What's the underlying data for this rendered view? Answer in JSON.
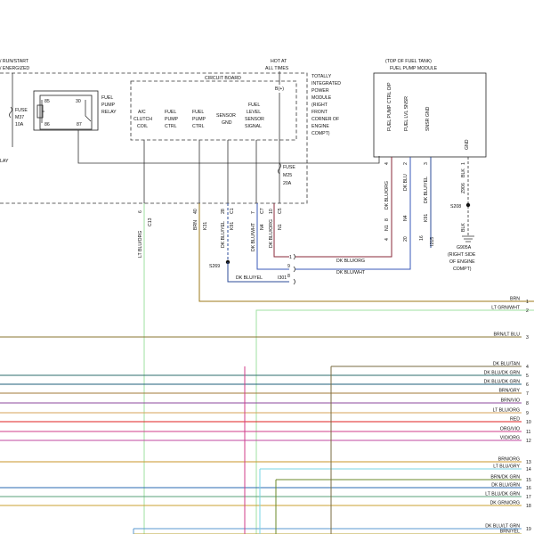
{
  "top_labels": {
    "run_start": "/ RUN/START",
    "energized": "/ ENERGIZED",
    "hot_at": "HOT AT",
    "all_times": "ALL TIMES",
    "circuit_board": "CIRCUIT BOARD",
    "b_plus": "B(+)"
  },
  "fuse_m37": {
    "l1": "FUSE",
    "l2": "M37",
    "l3": "10A"
  },
  "relay": {
    "p85": "85",
    "p30": "30",
    "p86": "86",
    "p87": "87",
    "l1": "FUEL",
    "l2": "PUMP",
    "l3": "RELAY",
    "left_fragment": "LAY"
  },
  "tipm": {
    "lines": [
      "TOTALLY",
      "INTEGRATED",
      "POWER",
      "MODULE",
      "(RIGHT",
      "FRONT",
      "CORNER OF",
      "ENGINE",
      "COMPT)"
    ]
  },
  "circuits": {
    "ac_clutch": [
      "A/C",
      "CLUTCH",
      "COIL"
    ],
    "fp_ctrl_1": [
      "FUEL",
      "PUMP",
      "CTRL"
    ],
    "fp_ctrl_2": [
      "FUEL",
      "PUMP",
      "CTRL"
    ],
    "sensor_gnd": [
      "SENSOR",
      "GND"
    ],
    "fuel_level": [
      "FUEL",
      "LEVEL",
      "SENSOR",
      "SIGNAL"
    ]
  },
  "fuse_m25": {
    "l1": "FUSE",
    "l2": "M25",
    "l3": "20A"
  },
  "fuel_pump_module": {
    "title1": "(TOP OF FUEL TANK)",
    "title2": "FUEL PUMP MODULE",
    "pins": [
      "FUEL PUMP CTRL O/P",
      "FUEL LVL SNSR",
      "SNSR GND",
      "GND"
    ]
  },
  "vertical_wires": {
    "w_ltbluorg": "LT BLU/ORG",
    "w_c13": "C13",
    "w_pin6": "6",
    "w_brn": "BRN",
    "w_k31": "K31",
    "w_pin40": "40",
    "w_dkbluyel": "DK BLU/YEL",
    "w_k91": "K91",
    "w_pin28": "28",
    "w_c1": "C1",
    "w_dkbluwht": "DK BLU/WHT",
    "w_n4": "N4",
    "w_pin7": "7",
    "w_c7": "C7",
    "w_dkbluorg": "DK BLU/ORG",
    "w_n1": "N1",
    "w_pin10": "10",
    "w_c5": "C5",
    "m_dkbluorg": "DK BLU/ORG",
    "m_n1": "N1",
    "m_pin4": "4",
    "m_8": "8",
    "m_dkblu": "DK BLU",
    "m_n4": "N4",
    "m_pin2": "2",
    "m_dkbluyel": "DK BLU/YEL",
    "m_k91": "K91",
    "m_pin3": "3",
    "m_z906": "Z906",
    "m_blk": "BLK",
    "m_pin1": "1",
    "b_4": "4",
    "b_20": "20",
    "b_16": "16",
    "b_i215": "I215"
  },
  "connector_i301": {
    "p1": "1",
    "p9": "9",
    "p8": "8",
    "w1": "DK BLU/ORG",
    "w2": "DK BLU/WHT",
    "w3": "DK BLU/YEL",
    "name": "I301",
    "splice": "S269"
  },
  "ground": {
    "splice": "S208",
    "blk": "BLK",
    "name": "G905A",
    "l1": "(RIGHT SIDE",
    "l2": "OF ENGINE",
    "l3": "COMPT)"
  },
  "right_wires": [
    {
      "label": "BRN",
      "pin": "1",
      "color": "#9c7a18"
    },
    {
      "label": "LT GRN/WHT",
      "pin": "2",
      "color": "#9fe0a0"
    },
    {
      "label": "BRN/LT BLU",
      "pin": "3",
      "color": "#8a7530"
    },
    {
      "label": "DK BLU/TAN",
      "pin": "4",
      "color": "#7a6b40"
    },
    {
      "label": "DK BLU/DK GRN",
      "pin": "5",
      "color": "#2d6e6e"
    },
    {
      "label": "DK BLU/DK GRN",
      "pin": "6",
      "color": "#1f5f7a"
    },
    {
      "label": "BRN/GRY",
      "pin": "7",
      "color": "#a07a3a"
    },
    {
      "label": "BRN/VIO",
      "pin": "8",
      "color": "#8c4a9c"
    },
    {
      "label": "LT BLU/ORG",
      "pin": "9",
      "color": "#d7a35a"
    },
    {
      "label": "RED",
      "pin": "10",
      "color": "#e02020"
    },
    {
      "label": "ORG/VIO",
      "pin": "11",
      "color": "#d23c8a"
    },
    {
      "label": "VIO/ORG",
      "pin": "12",
      "color": "#c14aa0"
    },
    {
      "label": "BRN/ORG",
      "pin": "13",
      "color": "#c8962a"
    },
    {
      "label": "LT BLU/GRY",
      "pin": "14",
      "color": "#79d6e6"
    },
    {
      "label": "BRN/DK GRN",
      "pin": "15",
      "color": "#6b8a2a"
    },
    {
      "label": "DK BLU/GRN",
      "pin": "16",
      "color": "#2a6ab0"
    },
    {
      "label": "LT BLU/DK GRN",
      "pin": "17",
      "color": "#5aa07a"
    },
    {
      "label": "DK GRN/ORG",
      "pin": "18",
      "color": "#c8a030"
    },
    {
      "label": "DK BLU/LT GRN",
      "pin": "19",
      "color": "#5a9ad0"
    },
    {
      "label": "BRN/YEL",
      "pin": "",
      "color": "#b9a030"
    }
  ]
}
